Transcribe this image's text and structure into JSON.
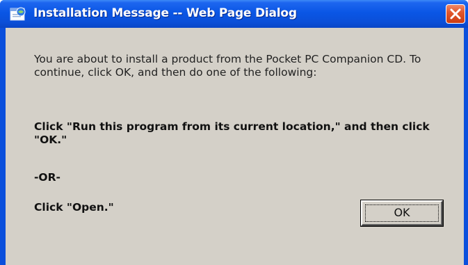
{
  "window": {
    "title": "Installation Message -- Web Page Dialog",
    "titlebar_color": "#0a56e5",
    "close_icon": "close-icon",
    "app_icon": "web-page-icon"
  },
  "dialog": {
    "intro": "You are about to install a product from the Pocket PC Companion CD. To continue, click OK, and then do one of the following:",
    "instruction_1": "Click \"Run this program from its current location,\" and then click \"OK.\"",
    "separator": "-OR-",
    "instruction_2": "Click \"Open.\"",
    "background_color": "#d4d0c8"
  },
  "buttons": {
    "ok_label": "OK"
  }
}
